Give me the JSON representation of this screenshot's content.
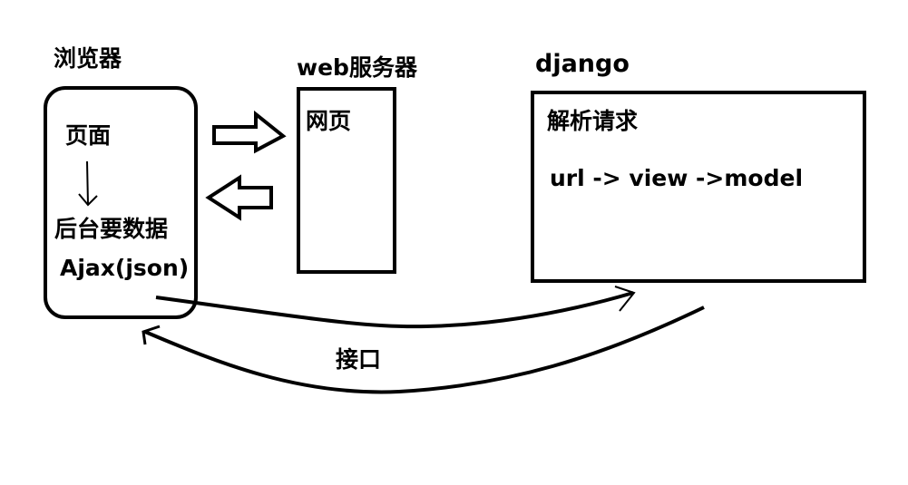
{
  "browser": {
    "title": "浏览器",
    "page_label": "页面",
    "backend_label": "后台要数据",
    "ajax_label": "Ajax(json)"
  },
  "web_server": {
    "title": "web服务器",
    "page_label": "网页"
  },
  "django": {
    "title": "django",
    "parse_label": "解析请求",
    "flow_label": "url -> view ->model"
  },
  "interface_label": "接口",
  "colors": {
    "stroke": "#000000",
    "background": "#ffffff"
  }
}
